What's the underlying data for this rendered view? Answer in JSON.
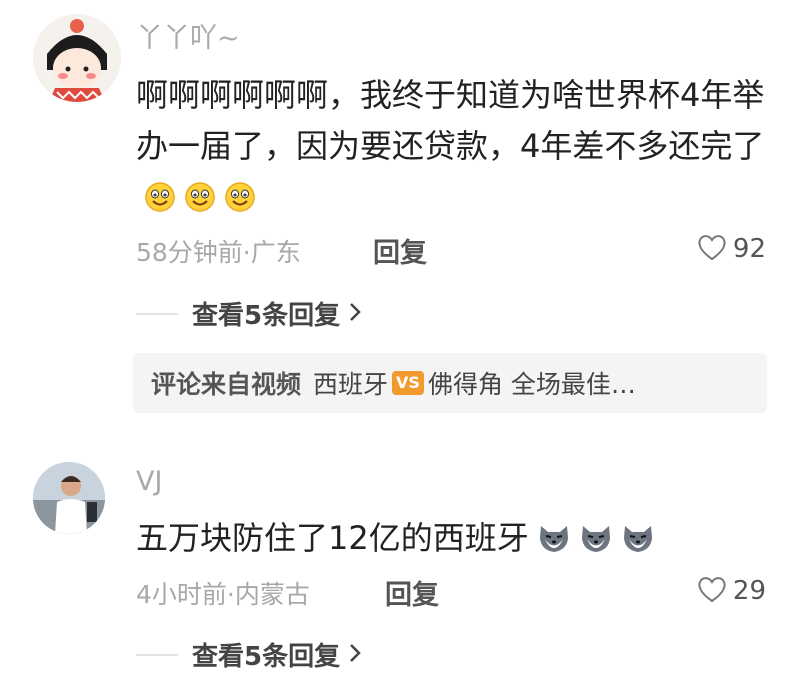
{
  "comments": [
    {
      "username": "丫丫吖~",
      "text": "啊啊啊啊啊啊，我终于知道为啥世界杯4年举办一届了，因为要还贷款，4年差不多还完了",
      "emoji": [
        "grin-emoji",
        "grin-emoji",
        "grin-emoji"
      ],
      "meta": "58分钟前·广东",
      "reply_label": "回复",
      "likes": "92",
      "view_replies": "查看5条回复",
      "source": {
        "prefix": "评论来自视频",
        "team1": "西班牙",
        "vs": "VS",
        "rest": "佛得角 全场最佳…"
      }
    },
    {
      "username": "VJ",
      "text": "五万块防住了12亿的西班牙",
      "emoji": [
        "wolf-emoji",
        "wolf-emoji",
        "wolf-emoji"
      ],
      "meta": "4小时前·内蒙古",
      "reply_label": "回复",
      "likes": "29",
      "view_replies": "查看5条回复"
    }
  ],
  "colors": {
    "accent_vs": "#f29a2e",
    "muted": "#a8a8a8"
  }
}
